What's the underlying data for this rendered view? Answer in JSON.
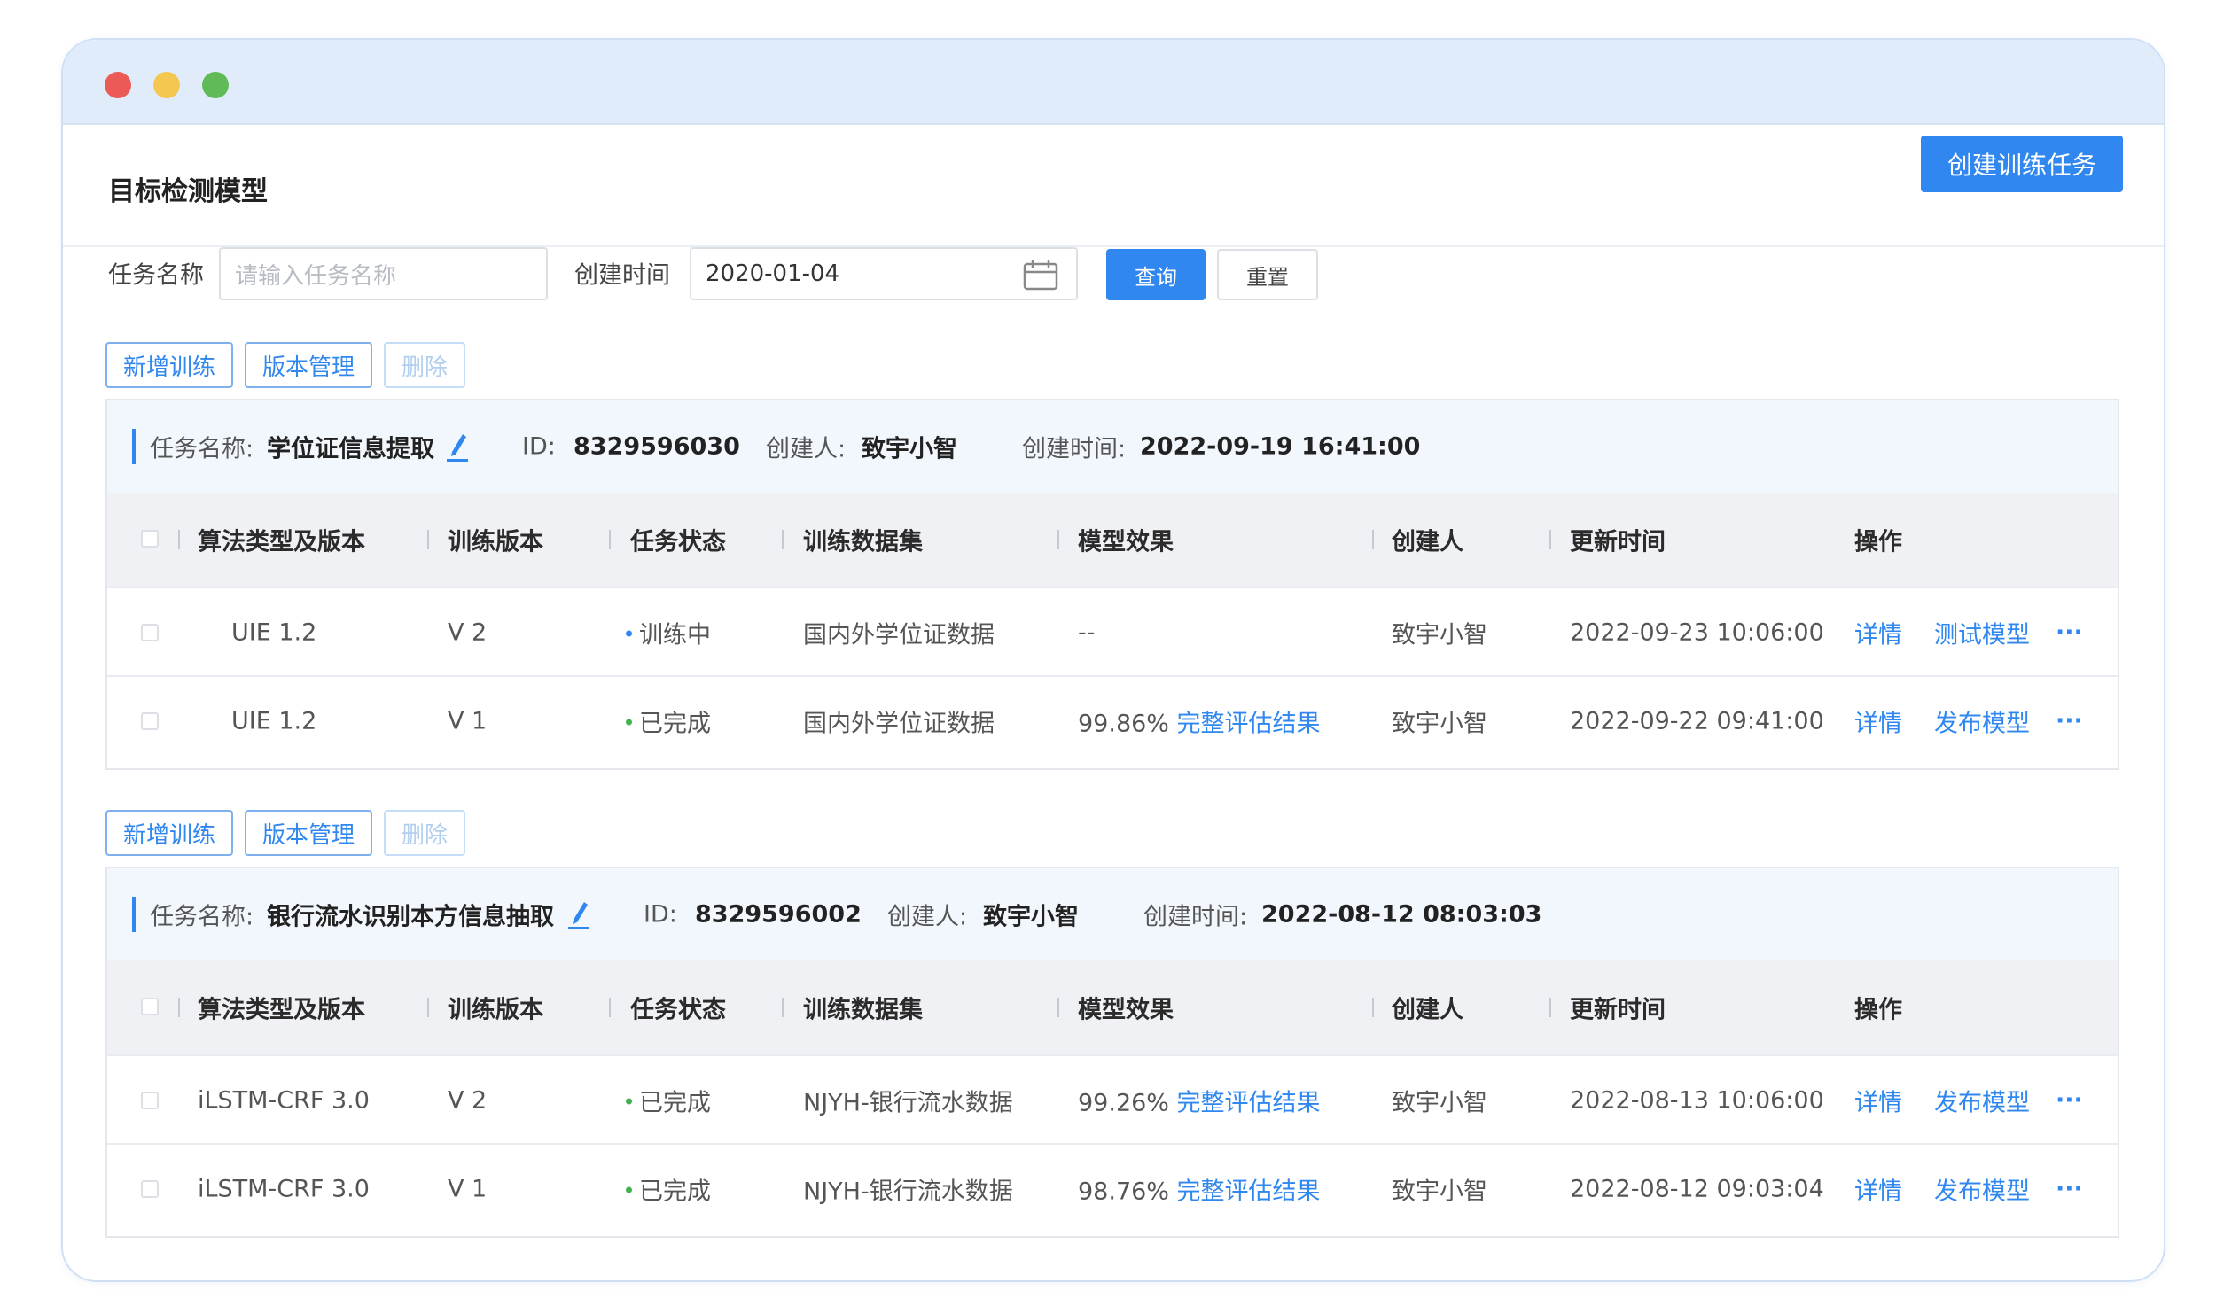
{
  "colors": {
    "primary": "#2f87ef",
    "status_training": "#2f87ef",
    "status_done": "#3fb24f"
  },
  "header": {
    "title": "目标检测模型",
    "create_button": "创建训练任务"
  },
  "filters": {
    "task_name_label": "任务名称",
    "task_name_placeholder": "请输入任务名称",
    "created_label": "创建时间",
    "created_value": "2020-01-04",
    "query_button": "查询",
    "reset_button": "重置"
  },
  "actions": {
    "add_training": "新增训练",
    "version_manage": "版本管理",
    "delete": "删除"
  },
  "table_headers": {
    "algorithm": "算法类型及版本",
    "version": "训练版本",
    "status": "任务状态",
    "dataset": "训练数据集",
    "effect": "模型效果",
    "creator": "创建人",
    "updated": "更新时间",
    "ops": "操作"
  },
  "groups": [
    {
      "name_key": "任务名称:",
      "name": "学位证信息提取",
      "id_key": "ID:",
      "id": "8329596030",
      "creator_key": "创建人:",
      "creator": "致宇小智",
      "time_key": "创建时间:",
      "time": "2022-09-19  16:41:00",
      "rows": [
        {
          "algorithm": "UIE 1.2",
          "version": "V 2",
          "status": "训练中",
          "dataset": "国内外学位证数据",
          "effect_value": "--",
          "effect_link": "",
          "creator": "致宇小智",
          "updated": "2022-09-23  10:06:00",
          "op1": "详情",
          "op2": "测试模型",
          "more": "···"
        },
        {
          "algorithm": "UIE 1.2",
          "version": "V 1",
          "status": "已完成",
          "dataset": "国内外学位证数据",
          "effect_value": "99.86%",
          "effect_link": "完整评估结果",
          "creator": "致宇小智",
          "updated": "2022-09-22  09:41:00",
          "op1": "详情",
          "op2": "发布模型",
          "more": "···"
        }
      ]
    },
    {
      "name_key": "任务名称:",
      "name": "银行流水识别本方信息抽取",
      "id_key": "ID:",
      "id": "8329596002",
      "creator_key": "创建人:",
      "creator": "致宇小智",
      "time_key": "创建时间:",
      "time": "2022-08-12  08:03:03",
      "rows": [
        {
          "algorithm": "iLSTM-CRF 3.0",
          "version": "V 2",
          "status": "已完成",
          "dataset": "NJYH-银行流水数据",
          "effect_value": "99.26%",
          "effect_link": "完整评估结果",
          "creator": "致宇小智",
          "updated": "2022-08-13  10:06:00",
          "op1": "详情",
          "op2": "发布模型",
          "more": "···"
        },
        {
          "algorithm": "iLSTM-CRF 3.0",
          "version": "V 1",
          "status": "已完成",
          "dataset": "NJYH-银行流水数据",
          "effect_value": "98.76%",
          "effect_link": "完整评估结果",
          "creator": "致宇小智",
          "updated": "2022-08-12  09:03:04",
          "op1": "详情",
          "op2": "发布模型",
          "more": "···"
        }
      ]
    }
  ]
}
